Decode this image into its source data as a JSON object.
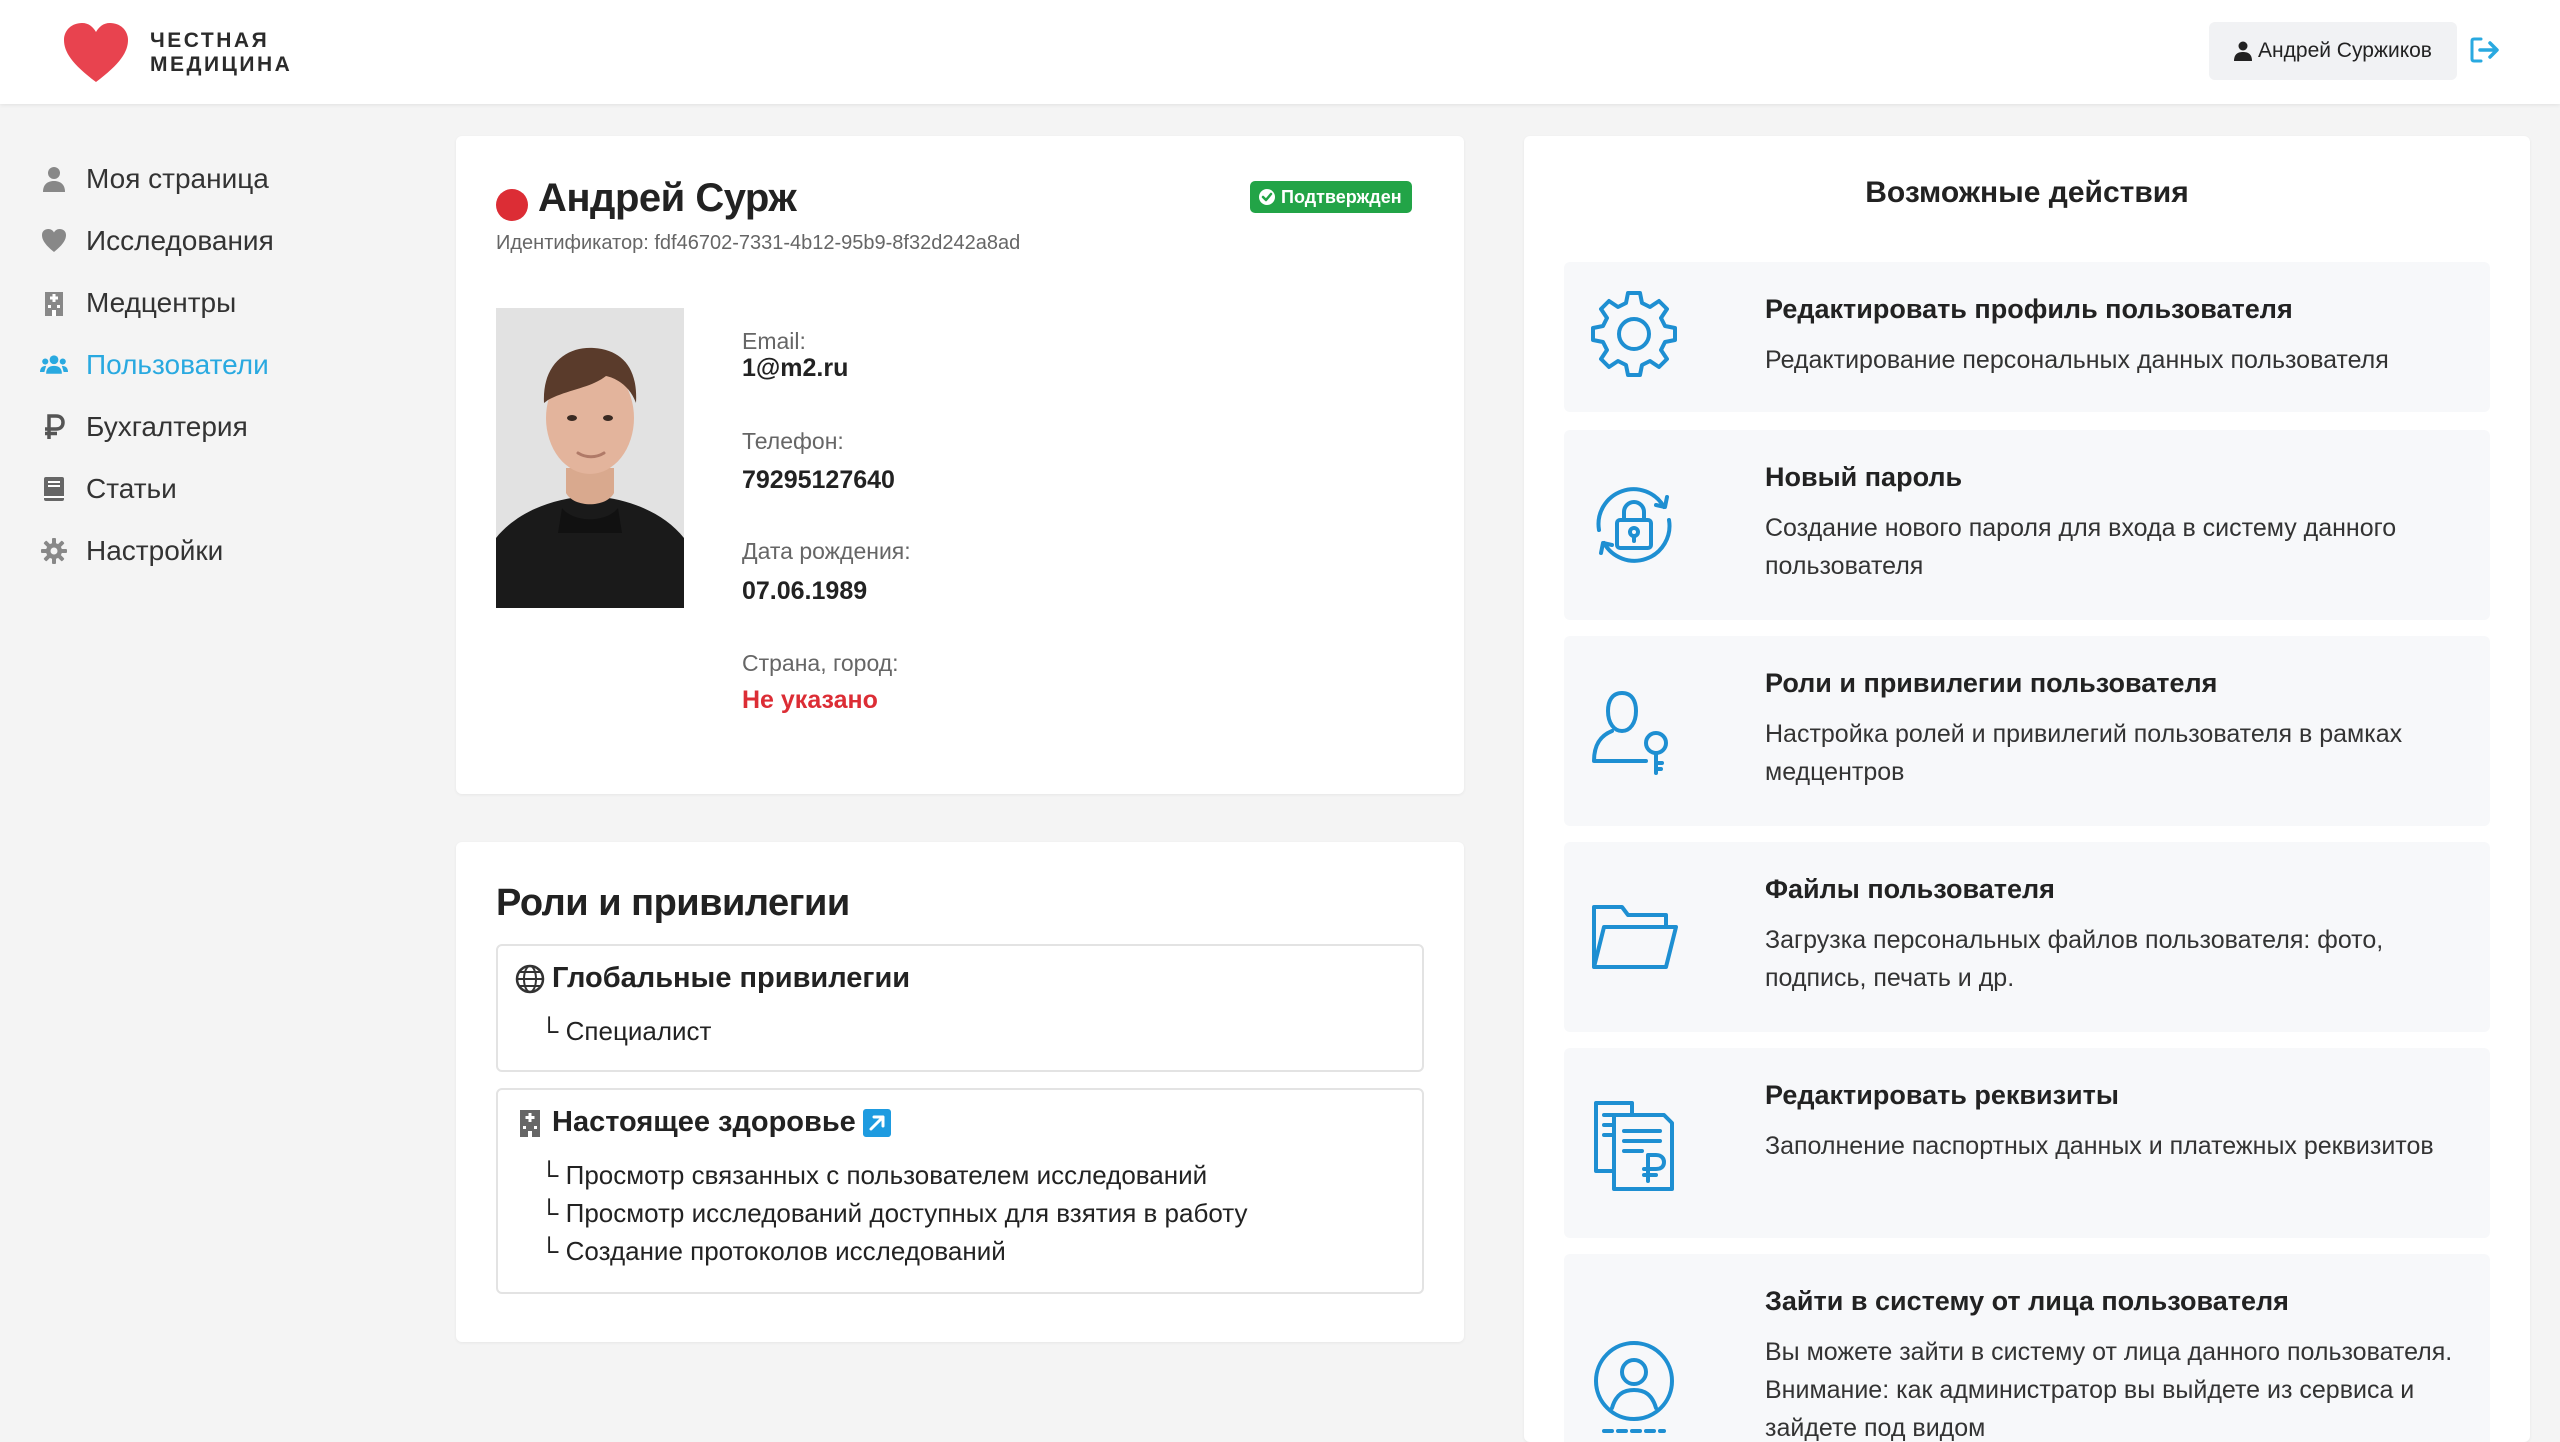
{
  "header": {
    "logo_line1": "ЧЕСТНАЯ",
    "logo_line2": "МЕДИЦИНА",
    "user_name": "Андрей Суржиков",
    "accent_color": "#29a9e0",
    "brand_color": "#e8434f"
  },
  "sidebar": {
    "items": [
      {
        "label": "Моя страница",
        "icon": "user-icon"
      },
      {
        "label": "Исследования",
        "icon": "heart-icon"
      },
      {
        "label": "Медцентры",
        "icon": "hospital-icon"
      },
      {
        "label": "Пользователи",
        "icon": "users-icon",
        "active": true
      },
      {
        "label": "Бухгалтерия",
        "icon": "ruble-icon"
      },
      {
        "label": "Статьи",
        "icon": "book-icon"
      },
      {
        "label": "Настройки",
        "icon": "gear-icon"
      }
    ]
  },
  "profile": {
    "name": "Андрей Сурж",
    "status_badge": "Подтвержден",
    "identifier": "Идентификатор: fdf46702-7331-4b12-95b9-8f32d242a8ad",
    "fields": {
      "email_label": "Email:",
      "email_value": "1@m2.ru",
      "phone_label": "Телефон:",
      "phone_value": "79295127640",
      "birth_label": "Дата рождения:",
      "birth_value": "07.06.1989",
      "location_label": "Страна, город:",
      "location_value": "Не указано"
    }
  },
  "roles": {
    "title": "Роли и привилегии",
    "groups": [
      {
        "name": "Глобальные привилегии",
        "icon": "globe-icon",
        "lines": [
          "└ Специалист"
        ]
      },
      {
        "name": "Настоящее здоровье",
        "icon": "hospital-icon",
        "lines": [
          "└ Просмотр связанных с пользователем исследований",
          "└ Просмотр исследований доступных для взятия в работу",
          "└ Создание протоколов исследований"
        ]
      }
    ]
  },
  "actions": {
    "title": "Возможные действия",
    "items": [
      {
        "title": "Редактировать профиль пользователя",
        "desc": "Редактирование персональных данных пользователя",
        "icon": "gear-icon"
      },
      {
        "title": "Новый пароль",
        "desc": "Создание нового пароля для входа в систему данного пользователя",
        "icon": "lock-refresh-icon"
      },
      {
        "title": "Роли и привилегии пользователя",
        "desc": "Настройка ролей и привилегий пользователя в рамках медцентров",
        "icon": "user-key-icon"
      },
      {
        "title": "Файлы пользователя",
        "desc": "Загрузка персональных файлов пользователя: фото, подпись, печать и др.",
        "icon": "folder-icon"
      },
      {
        "title": "Редактировать реквизиты",
        "desc": "Заполнение паспортных данных и платежных реквизитов",
        "icon": "documents-ruble-icon"
      },
      {
        "title": "Зайти в систему от лица пользователя",
        "desc": "Вы можете зайти в систему от лица данного пользователя. Внимание: как администратор вы выйдете из сервиса и зайдете под видом",
        "icon": "user-circle-icon"
      }
    ]
  }
}
